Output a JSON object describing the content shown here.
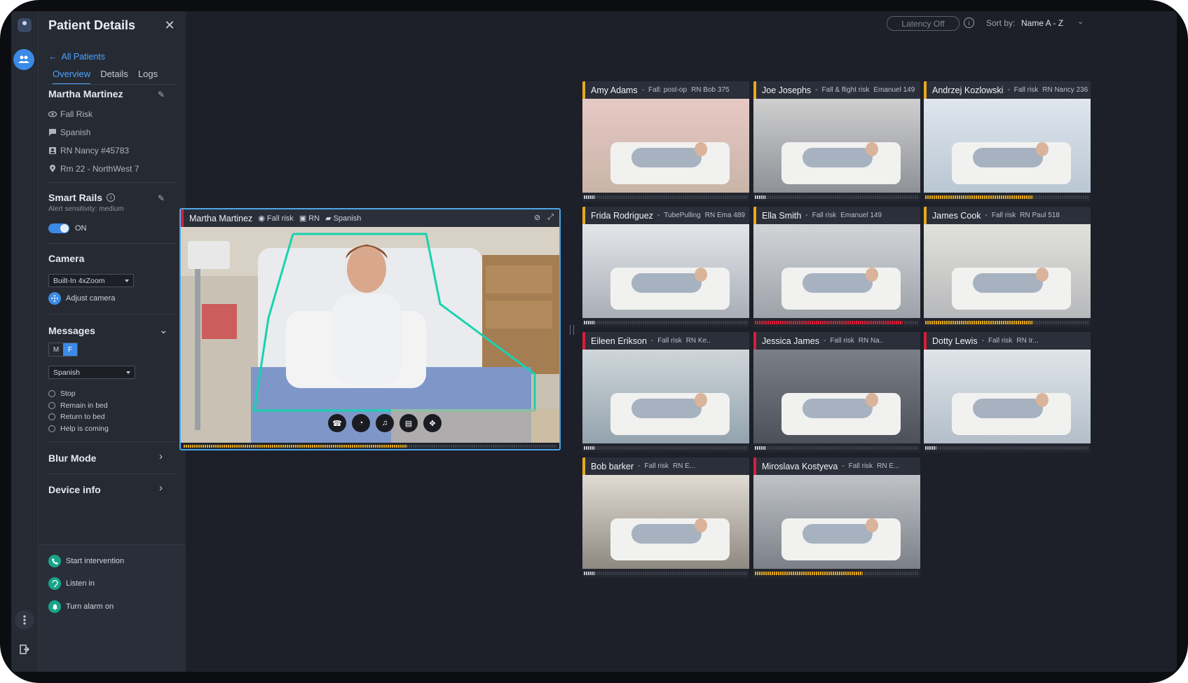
{
  "panel": {
    "title": "Patient Details",
    "back_label": "All Patients",
    "tabs": [
      "Overview",
      "Details",
      "Logs"
    ],
    "patient_name": "Martha Martinez",
    "info": [
      "Fall Risk",
      "Spanish",
      "RN Nancy #45783",
      "Rm 22 - NorthWest 7"
    ],
    "smart_rails": {
      "title": "Smart Rails",
      "sensitivity": "Alert sensitivity: medium",
      "toggle_label": "ON"
    },
    "camera": {
      "title": "Camera",
      "selected": "Built-In 4xZoom",
      "adjust_label": "Adjust camera"
    },
    "messages": {
      "title": "Messages",
      "gender_options": [
        "M",
        "F"
      ],
      "language": "Spanish",
      "items": [
        "Stop",
        "Remain in bed",
        "Return to bed",
        "Help is coming"
      ]
    },
    "blur_mode": "Blur Mode",
    "device_info": "Device info",
    "actions": [
      "Start intervention",
      "Listen in",
      "Turn alarm on"
    ]
  },
  "topbar": {
    "latency": "Latency Off",
    "sort_label": "Sort by:",
    "sort_value": "Name A - Z"
  },
  "main_feed": {
    "name": "Martha Martinez",
    "risk": "Fall risk",
    "nurse": "RN",
    "language": "Spanish",
    "progress": 0.6
  },
  "tiles": [
    {
      "name": "Amy Adams",
      "risk": "Fall: post-op",
      "nurse": "RN Bob 375",
      "status": "yellow",
      "bar_color": "white",
      "bar": 0.07
    },
    {
      "name": "Joe Josephs",
      "risk": "Fall & flight risk",
      "nurse": "Emanuel 149",
      "status": "yellow",
      "bar_color": "white",
      "bar": 0.07
    },
    {
      "name": "Andrzej Kozlowski",
      "risk": "Fall risk",
      "nurse": "RN Nancy 236",
      "status": "yellow",
      "bar_color": "yellow",
      "bar": 0.66
    },
    {
      "name": "Frida Rodriguez",
      "risk": "TubePulling",
      "nurse": "RN Ema 489",
      "status": "yellow",
      "bar_color": "white",
      "bar": 0.07
    },
    {
      "name": "Ella Smith",
      "risk": "Fall risk",
      "nurse": "Emanuel 149",
      "status": "yellow",
      "bar_color": "red",
      "bar": 0.9
    },
    {
      "name": "James Cook",
      "risk": "Fall risk",
      "nurse": "RN Paul 518",
      "status": "yellow",
      "bar_color": "yellow",
      "bar": 0.66
    },
    {
      "name": "Eileen Erikson",
      "risk": "Fall risk",
      "nurse": "RN Ke..",
      "status": "red",
      "bar_color": "white",
      "bar": 0.07
    },
    {
      "name": "Jessica James",
      "risk": "Fall risk",
      "nurse": "RN Na..",
      "status": "red",
      "bar_color": "white",
      "bar": 0.07
    },
    {
      "name": "Dotty Lewis",
      "risk": "Fall risk",
      "nurse": "RN Ir...",
      "status": "red",
      "bar_color": "white",
      "bar": 0.07
    },
    {
      "name": "Bob barker",
      "risk": "Fall risk",
      "nurse": "RN E...",
      "status": "yellow",
      "bar_color": "white",
      "bar": 0.07
    },
    {
      "name": "Miroslava Kostyeva",
      "risk": "Fall risk",
      "nurse": "RN E...",
      "status": "red",
      "bar_color": "yellow",
      "bar": 0.66
    }
  ]
}
